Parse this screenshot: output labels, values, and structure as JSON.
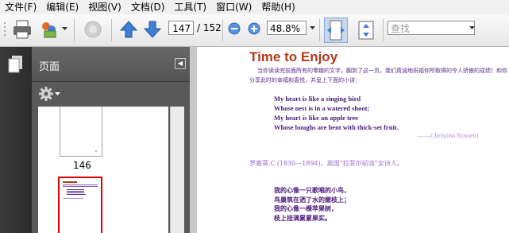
{
  "menu": [
    "文件(F)",
    "编辑(E)",
    "视图(V)",
    "文档(D)",
    "工具(T)",
    "窗口(W)",
    "帮助(H)"
  ],
  "toolbar": {
    "page_current": "147",
    "page_total": "/ 152",
    "zoom": "48.8%",
    "search_placeholder": "查找"
  },
  "panel": {
    "title": "页面",
    "thumbnail_label": "146"
  },
  "document": {
    "title": "Time to Enjoy",
    "intro": "当你读读完前面所有的零趣的文字，翻到了这一页，我们真诚地祝福你所取得的令人骄傲的成绩！和你分享此时的幸福和喜悦，并呈上下面的小诗：",
    "poem_lines": [
      "My heart is like a singing bird",
      "Whose nest is in a watered shoot;",
      "My heart is like an apple tree",
      "Whose boughs are bent with thick-set fruit."
    ],
    "author": "——Christina  Rossetti",
    "author_note": "罗塞蒂.C.(1830—1894)，英国“拉菲尔前派”女诗人。",
    "cn_lines": [
      "我的心像一只歌唱的小鸟，",
      "鸟巢筑在洒了水的嫩枝上；",
      "我的心像一棵苹果树，",
      "枝上挂满累累果实。"
    ]
  },
  "colors": {
    "title": "#b03a1e",
    "intro": "#5a2a8a",
    "poem": "#4a1a7a",
    "author": "#b38ad9",
    "note": "#9a6fd4",
    "thumb_selected": "#e00000"
  }
}
